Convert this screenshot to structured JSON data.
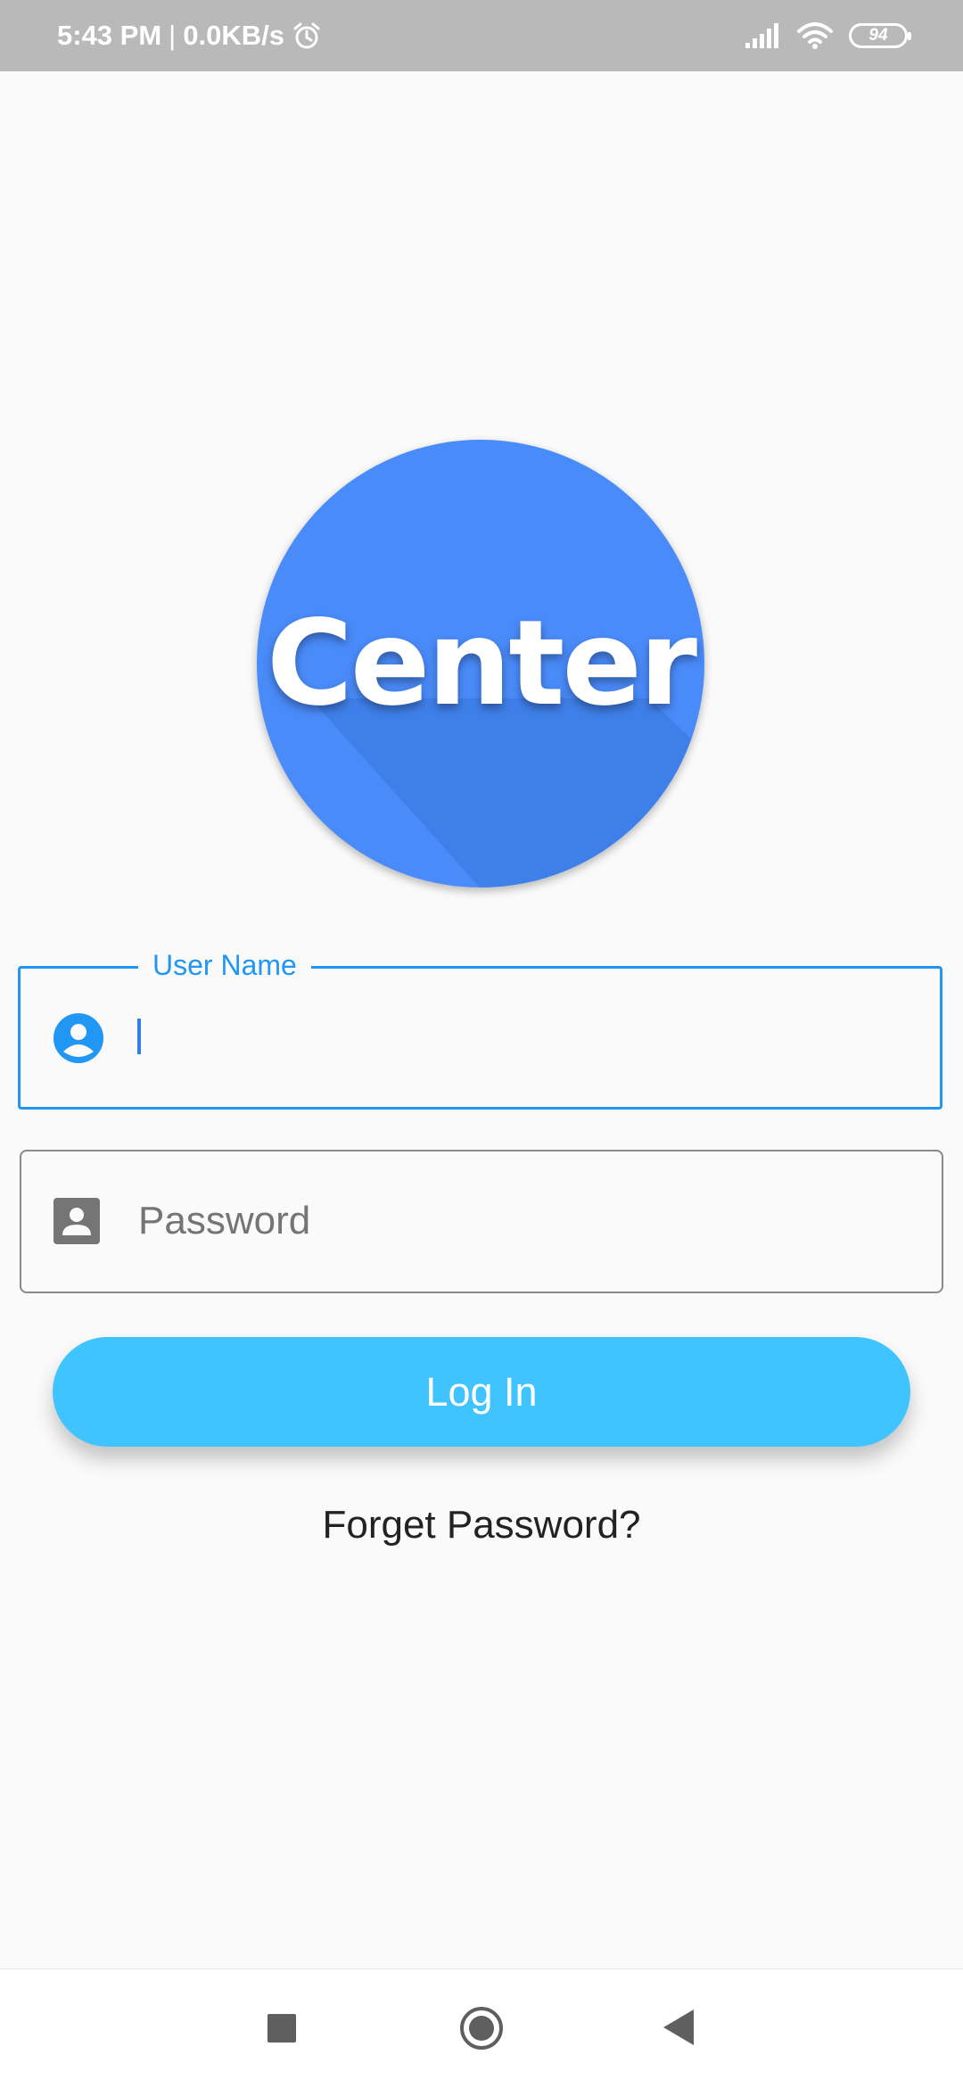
{
  "status_bar": {
    "time": "5:43 PM",
    "separator": "|",
    "network_speed": "0.0KB/s",
    "alarm_icon": "alarm-clock-icon",
    "signal_icon": "cellular-signal-icon",
    "wifi_icon": "wifi-icon",
    "battery_level": "94"
  },
  "logo": {
    "text": "Center",
    "color": "#4a8bfa"
  },
  "form": {
    "username": {
      "label": "User Name",
      "value": "",
      "icon": "account-circle-icon",
      "focused": true,
      "accent": "#2196f3"
    },
    "password": {
      "placeholder": "Password",
      "value": "",
      "icon": "contact-card-icon"
    },
    "login_button": {
      "label": "Log In",
      "color": "#40c4ff"
    },
    "forget_link": "Forget Password?"
  },
  "nav_bar": {
    "recents_icon": "square-recents-icon",
    "home_icon": "circle-home-icon",
    "back_icon": "triangle-back-icon"
  }
}
